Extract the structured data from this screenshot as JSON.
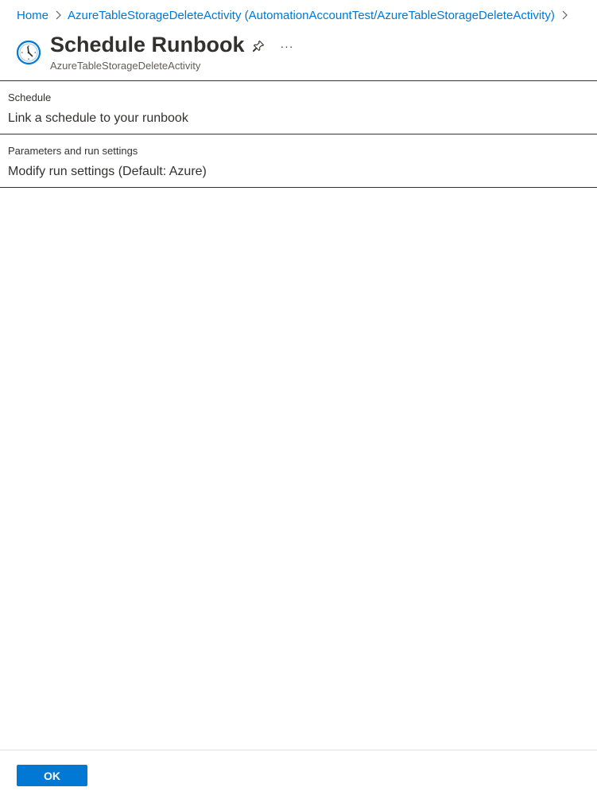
{
  "breadcrumb": {
    "items": [
      {
        "label": "Home"
      },
      {
        "label": "AzureTableStorageDeleteActivity (AutomationAccountTest/AzureTableStorageDeleteActivity)"
      }
    ]
  },
  "header": {
    "title": "Schedule Runbook",
    "subtitle": "AzureTableStorageDeleteActivity",
    "more_label": "···",
    "icon": "clock-icon"
  },
  "sections": [
    {
      "label": "Schedule",
      "link": "Link a schedule to your runbook"
    },
    {
      "label": "Parameters and run settings",
      "link": "Modify run settings (Default: Azure)"
    }
  ],
  "footer": {
    "ok_label": "OK"
  },
  "colors": {
    "accent": "#0078d4",
    "text": "#323130",
    "muted": "#605e5c"
  }
}
